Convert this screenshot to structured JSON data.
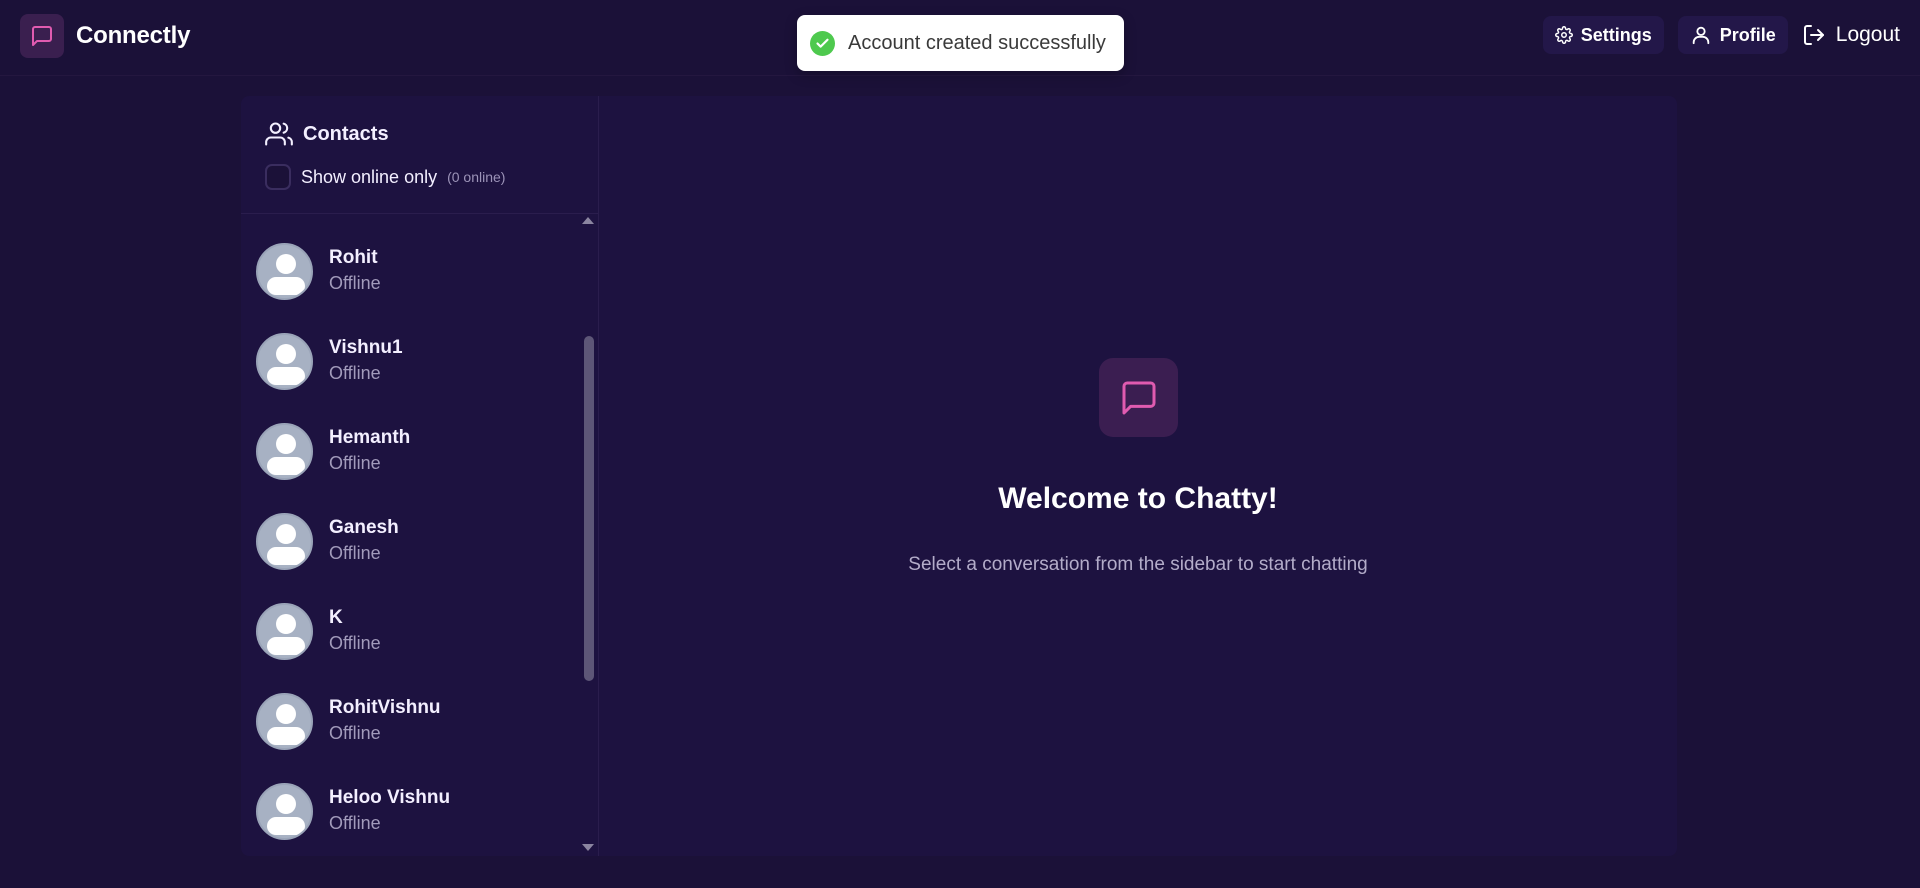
{
  "brand": {
    "name": "Connectly",
    "icon": "message-square-icon"
  },
  "nav": {
    "settings_label": "Settings",
    "profile_label": "Profile",
    "logout_label": "Logout"
  },
  "toast": {
    "message": "Account created successfully",
    "icon": "check-circle-icon"
  },
  "sidebar": {
    "title": "Contacts",
    "filter_label": "Show online only",
    "online_count": "(0 online)",
    "contacts": [
      {
        "name": "Rohit",
        "status": "Offline"
      },
      {
        "name": "Vishnu1",
        "status": "Offline"
      },
      {
        "name": "Hemanth",
        "status": "Offline"
      },
      {
        "name": "Ganesh",
        "status": "Offline"
      },
      {
        "name": "K",
        "status": "Offline"
      },
      {
        "name": "RohitVishnu",
        "status": "Offline"
      },
      {
        "name": "Heloo Vishnu",
        "status": "Offline"
      }
    ]
  },
  "welcome": {
    "title": "Welcome to Chatty!",
    "subtitle": "Select a conversation from the sidebar to start chatting"
  },
  "colors": {
    "background": "#1b1138",
    "accent_pink": "#e05bb0",
    "toast_success": "#4ec94e"
  }
}
